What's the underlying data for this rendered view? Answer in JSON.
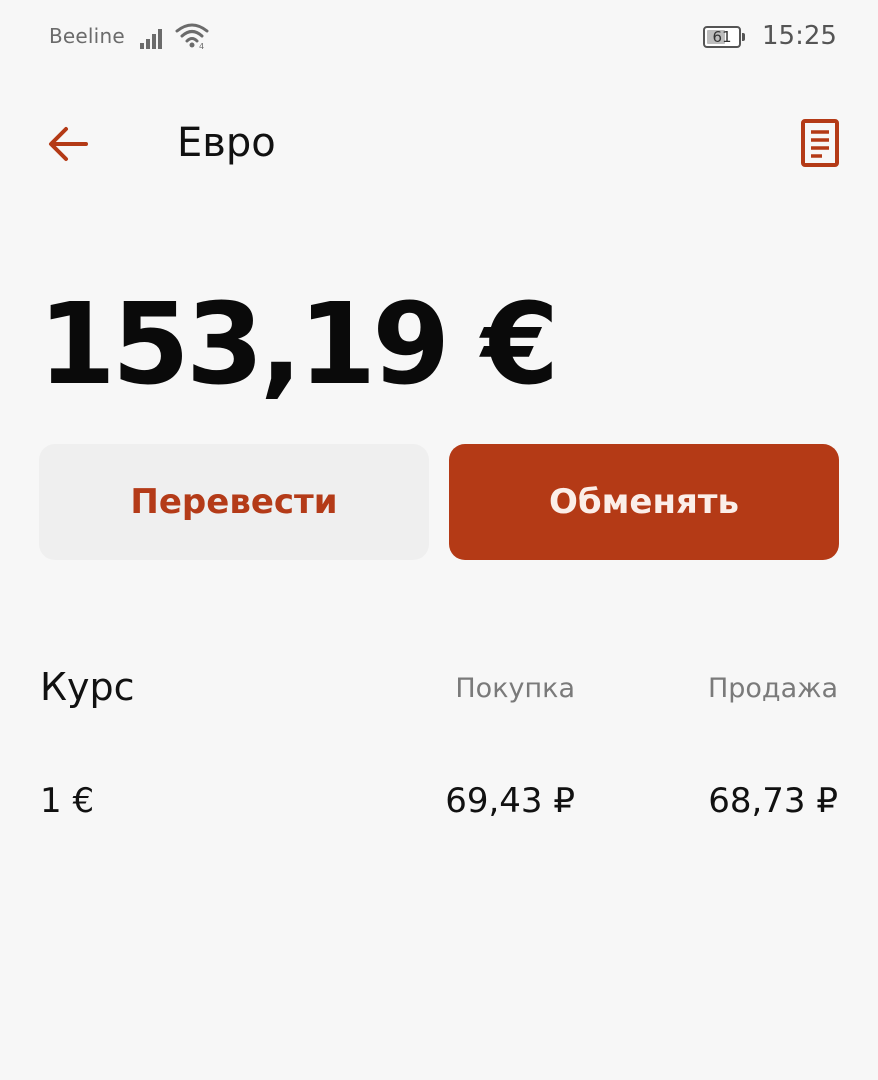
{
  "status_bar": {
    "carrier": "Beeline",
    "battery_percent": "61",
    "battery_level": 0.61,
    "time": "15:25"
  },
  "header": {
    "title": "Евро"
  },
  "balance": {
    "amount": "153,19 €"
  },
  "actions": {
    "transfer_label": "Перевести",
    "exchange_label": "Обменять"
  },
  "rates": {
    "title": "Курс",
    "columns": {
      "buy": "Покупка",
      "sell": "Продажа"
    },
    "rows": [
      {
        "unit": "1 €",
        "buy": "69,43 ₽",
        "sell": "68,73 ₽"
      }
    ]
  },
  "colors": {
    "accent": "#b43a16",
    "background": "#f7f7f7",
    "secondary_button": "#efefef"
  },
  "icons": {
    "back": "arrow-left-icon",
    "statement": "document-icon",
    "signal": "cellular-signal-icon",
    "wifi": "wifi-icon",
    "battery": "battery-icon"
  }
}
